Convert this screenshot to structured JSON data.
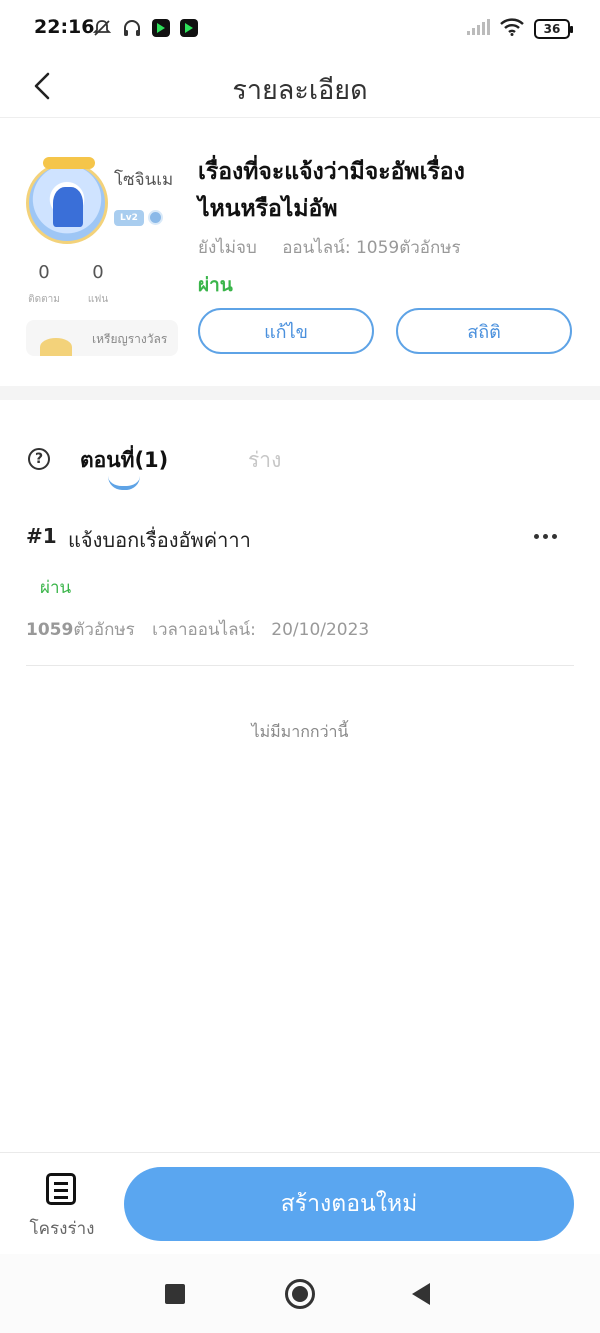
{
  "status_bar": {
    "time": "22:16",
    "battery": "36",
    "icons": [
      "mute-bell-icon",
      "headphones-icon",
      "app-notification-icon",
      "app-notification-icon",
      "signal-icon",
      "wifi-icon",
      "battery-icon"
    ]
  },
  "nav": {
    "title": "รายละเอียด",
    "back_icon": "back-arrow-icon"
  },
  "author": {
    "name": "โซจินเม",
    "level": "Lv2",
    "following_count": "0",
    "following_label": "ติดตาม",
    "fans_count": "0",
    "fans_label": "แฟน",
    "medal_label": "เหรียญรางวัลร"
  },
  "work": {
    "title": "เรื่องที่จะแจ้งว่ามีจะอัพเรื่องไหนหรือไม่อัพ",
    "progress": "ยังไม่จบ",
    "online_chars": "ออนไลน์: 1059ตัวอักษร",
    "status": "ผ่าน",
    "edit_label": "แก้ไข",
    "stats_label": "สถิติ"
  },
  "tabs": [
    {
      "label": "ตอนที่(1)",
      "active": true
    },
    {
      "label": "ร่าง",
      "active": false
    }
  ],
  "chapters": [
    {
      "number": "#1",
      "title": "แจ้งบอกเรื่องอัพค่าาา",
      "status": "ผ่าน",
      "char_count": "1059",
      "char_unit": "ตัวอักษร",
      "time_label": "เวลาออนไลน์:",
      "date": "20/10/2023"
    }
  ],
  "list_end_text": "ไม่มีมากกว่านี้",
  "bottom_bar": {
    "outline_label": "โครงร่าง",
    "outline_icon": "document-icon",
    "create_label": "สร้างตอนใหม่"
  },
  "colors": {
    "accent": "#5aa6f0",
    "success": "#3ab54a",
    "muted": "#999999"
  }
}
